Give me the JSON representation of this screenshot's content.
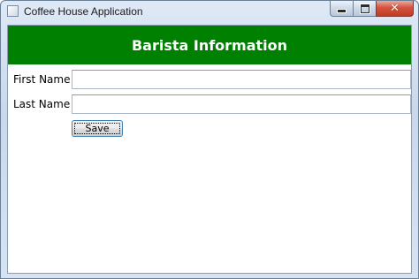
{
  "window": {
    "title": "Coffee House Application",
    "close_glyph": "✕"
  },
  "header": {
    "title": "Barista Information",
    "background": "#008000",
    "text_color": "#ffffff"
  },
  "form": {
    "first_name_label": "First Name",
    "first_name_value": "",
    "last_name_label": "Last Name",
    "last_name_value": "",
    "save_label": "Save"
  }
}
